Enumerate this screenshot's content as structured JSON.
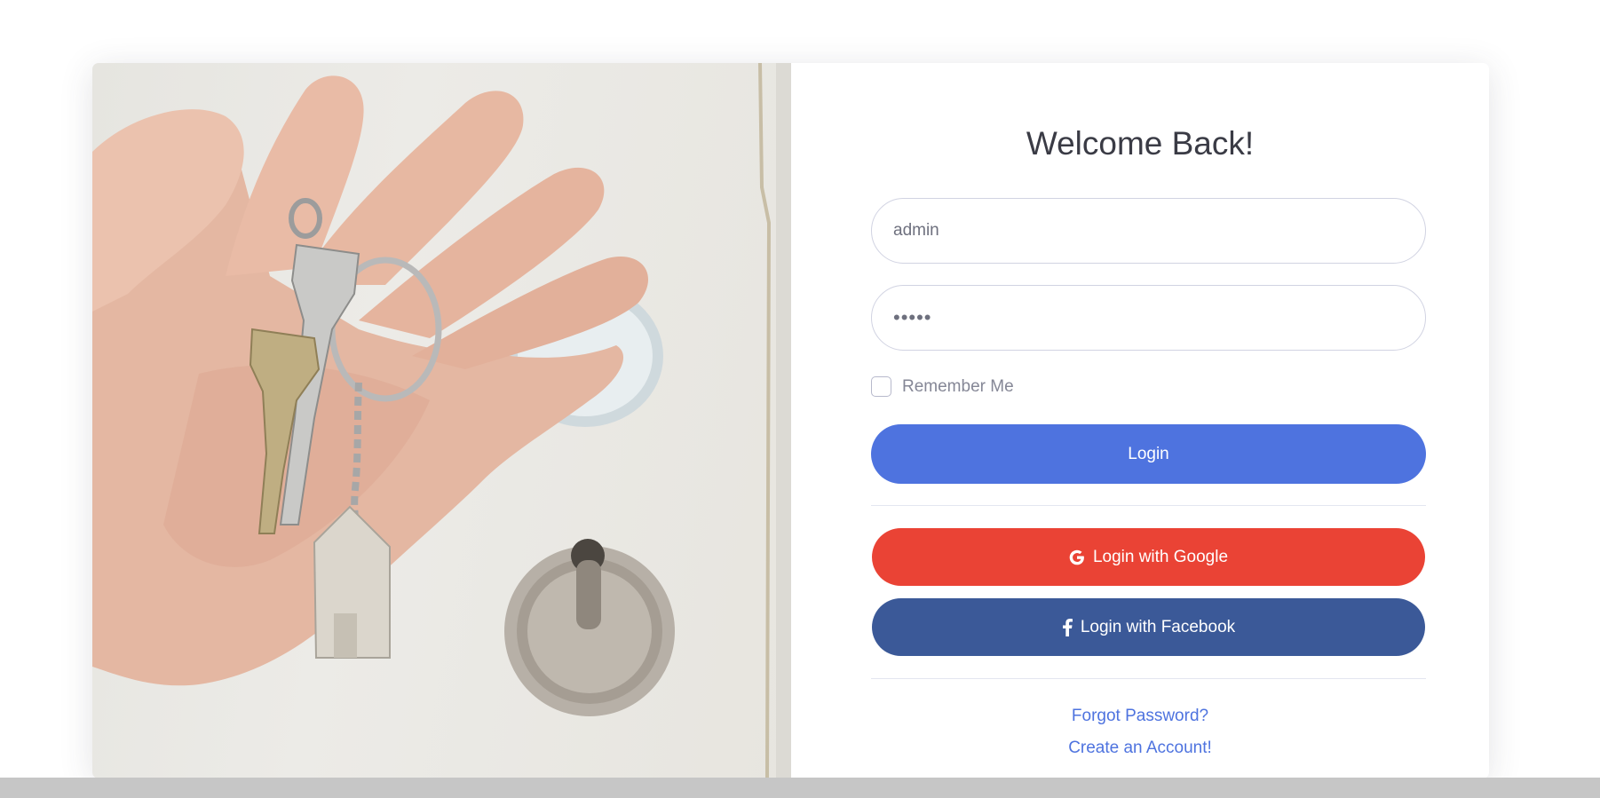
{
  "login": {
    "title": "Welcome Back!",
    "username_value": "admin",
    "password_value": "•••••",
    "remember_label": "Remember Me",
    "login_label": "Login",
    "google_label": "Login with Google",
    "facebook_label": "Login with Facebook",
    "forgot_label": "Forgot Password?",
    "create_label": "Create an Account!"
  },
  "icons": {
    "google": "google-icon",
    "facebook": "facebook-icon"
  },
  "colors": {
    "primary": "#4e73df",
    "google": "#ea4335",
    "facebook": "#3b5998"
  }
}
